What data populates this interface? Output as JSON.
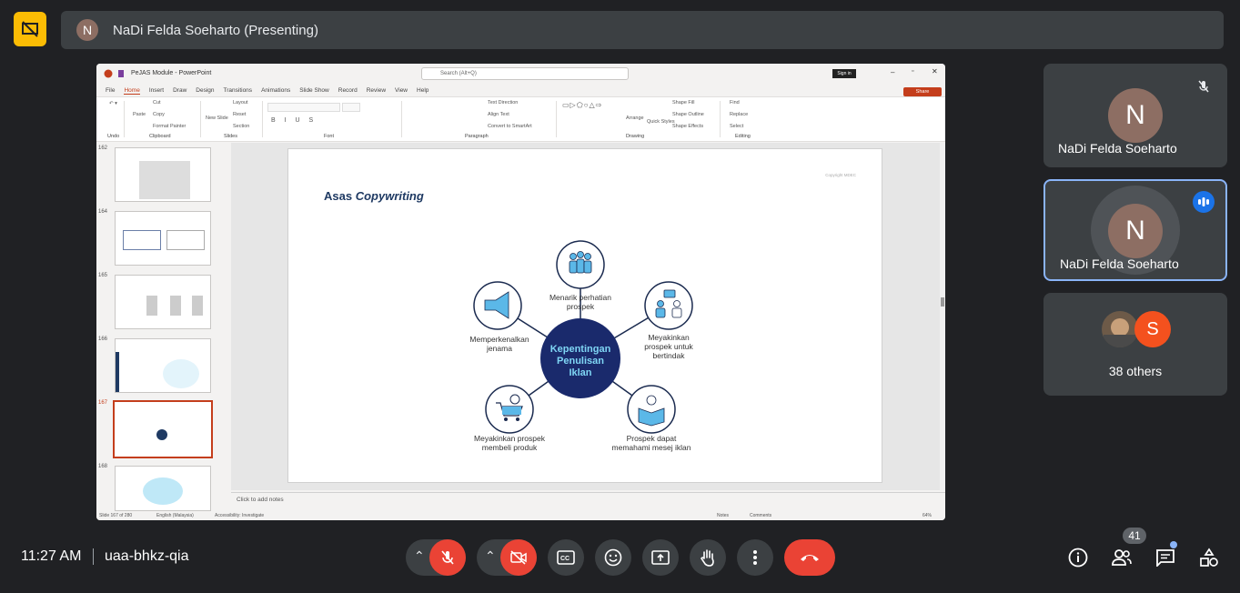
{
  "header": {
    "presenter_initial": "N",
    "presenter_label": "NaDi Felda Soeharto (Presenting)"
  },
  "powerpoint": {
    "window_title": "PeJAS Module - PowerPoint",
    "search_placeholder": "Search (Alt+Q)",
    "sign_in": "Sign in",
    "share": "Share",
    "menu": [
      "File",
      "Home",
      "Insert",
      "Draw",
      "Design",
      "Transitions",
      "Animations",
      "Slide Show",
      "Record",
      "Review",
      "View",
      "Help"
    ],
    "ribbon": {
      "undo": "Undo",
      "clipboard": "Clipboard",
      "cut": "Cut",
      "copy": "Copy",
      "paste": "Paste",
      "format_painter": "Format Painter",
      "new_slide": "New Slide",
      "layout": "Layout",
      "reset": "Reset",
      "section": "Section",
      "slides": "Slides",
      "font": "Font",
      "paragraph": "Paragraph",
      "text_direction": "Text Direction",
      "align_text": "Align Text",
      "convert_smartart": "Convert to SmartArt",
      "drawing": "Drawing",
      "arrange": "Arrange",
      "quick_styles": "Quick Styles",
      "shape_fill": "Shape Fill",
      "shape_outline": "Shape Outline",
      "shape_effects": "Shape Effects",
      "find": "Find",
      "replace": "Replace",
      "select": "Select",
      "editing": "Editing"
    },
    "thumbnails": [
      {
        "num": "162"
      },
      {
        "num": "164"
      },
      {
        "num": "165"
      },
      {
        "num": "166"
      },
      {
        "num": "167",
        "selected": true
      },
      {
        "num": "168"
      }
    ],
    "slide": {
      "title_plain": "Asas ",
      "title_italic": "Copywriting",
      "copyright": "Copyright MDEC",
      "center": [
        "Kepentingan",
        "Penulisan",
        "Iklan"
      ],
      "nodes": {
        "top": [
          "Menarik perhatian",
          "prospek"
        ],
        "left": [
          "Memperkenalkan",
          "jenama"
        ],
        "right": [
          "Meyakinkan",
          "prospek untuk",
          "bertindak"
        ],
        "bottom_left": [
          "Meyakinkan prospek",
          "membeli produk"
        ],
        "bottom_right": [
          "Prospek dapat",
          "memahami mesej iklan"
        ]
      }
    },
    "notes_placeholder": "Click to add notes",
    "status": {
      "slide_of": "Slide 167 of 280",
      "language": "English (Malaysia)",
      "accessibility": "Accessibility: Investigate",
      "notes": "Notes",
      "comments": "Comments",
      "zoom": "64%"
    }
  },
  "participants": [
    {
      "initial": "N",
      "name": "NaDi Felda Soeharto",
      "muted": true
    },
    {
      "initial": "N",
      "name": "NaDi Felda Soeharto",
      "speaking": true
    },
    {
      "others_initial": "S",
      "others_label": "38 others"
    }
  ],
  "bottom": {
    "time": "11:27 AM",
    "meeting_code": "uaa-bhkz-qia",
    "people_count": "41"
  },
  "colors": {
    "background": "#202124",
    "tile": "#3c4043",
    "danger": "#ea4335",
    "accent": "#8ab4f8",
    "warning": "#fbbc04",
    "slide_navy": "#1f3a63"
  }
}
